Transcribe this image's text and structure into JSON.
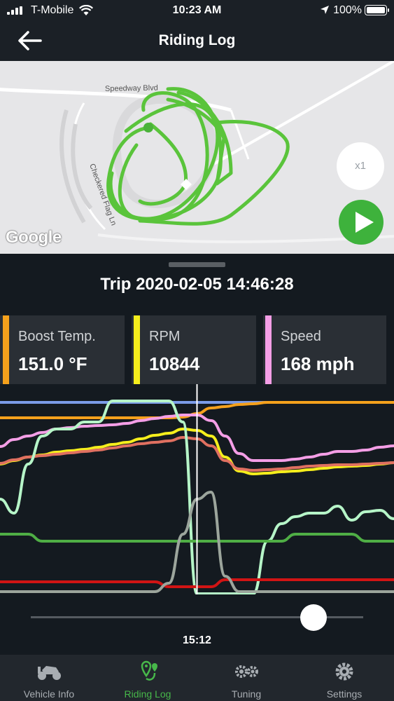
{
  "status_bar": {
    "carrier": "T-Mobile",
    "time": "10:23 AM",
    "battery": "100%"
  },
  "header": {
    "title": "Riding Log"
  },
  "map": {
    "street_1": "Speedway Blvd",
    "street_2": "Checkered Flag Ln",
    "playback_speed": "x1",
    "attribution": "Google"
  },
  "trip": {
    "title": "Trip 2020-02-05 14:46:28"
  },
  "metrics": [
    {
      "label": "Boost Temp.",
      "value": "151.0 °F",
      "color": "#f5a11c"
    },
    {
      "label": "RPM",
      "value": "10844",
      "color": "#f5ee1c"
    },
    {
      "label": "Speed",
      "value": "168 mph",
      "color": "#f49ee6"
    }
  ],
  "chart_data": {
    "type": "line",
    "series": [
      {
        "color": "#7b9be8",
        "values": [
          2,
          2,
          2,
          2,
          2,
          2,
          2,
          2,
          2,
          2,
          2,
          2,
          2,
          2,
          2,
          2,
          2,
          2,
          2,
          2,
          2,
          2,
          2,
          2,
          2,
          2,
          2,
          2,
          2
        ]
      },
      {
        "color": "#f5a11c",
        "values": [
          24,
          24,
          24,
          24,
          24,
          24,
          24,
          24,
          24,
          24,
          24,
          24,
          24,
          23,
          18,
          10,
          8,
          5,
          4,
          2,
          2,
          2,
          2,
          2,
          2,
          2,
          2,
          2,
          2
        ]
      },
      {
        "color": "#f49ee6",
        "values": [
          65,
          55,
          50,
          45,
          40,
          38,
          36,
          35,
          34,
          32,
          28,
          25,
          22,
          20,
          20,
          28,
          50,
          75,
          85,
          85,
          85,
          83,
          80,
          76,
          72,
          72,
          70,
          66,
          64
        ]
      },
      {
        "color": "#f5ee1c",
        "values": [
          90,
          85,
          80,
          77,
          73,
          71,
          69,
          66,
          62,
          59,
          54,
          49,
          46,
          40,
          42,
          50,
          80,
          100,
          104,
          103,
          101,
          100,
          98,
          96,
          94,
          93,
          92,
          90,
          88
        ]
      },
      {
        "color": "#e07060",
        "values": [
          89,
          84,
          80,
          78,
          76,
          74,
          72,
          70,
          67,
          64,
          61,
          59,
          57,
          52,
          54,
          64,
          85,
          97,
          99,
          98,
          97,
          95,
          93,
          92,
          91,
          91,
          90,
          89,
          88
        ]
      },
      {
        "color": "#b6f5c8",
        "values": [
          140,
          160,
          90,
          50,
          40,
          40,
          30,
          30,
          0,
          0,
          0,
          0,
          0,
          30,
          275,
          275,
          275,
          275,
          275,
          200,
          175,
          165,
          160,
          160,
          150,
          170,
          158,
          156,
          168
        ]
      },
      {
        "color": "#4fae45",
        "values": [
          190,
          190,
          190,
          200,
          200,
          200,
          200,
          200,
          200,
          200,
          200,
          200,
          200,
          200,
          200,
          200,
          200,
          200,
          200,
          200,
          200,
          190,
          190,
          190,
          190,
          190,
          200,
          200,
          200
        ]
      },
      {
        "color": "#d11414",
        "values": [
          258,
          258,
          258,
          258,
          258,
          258,
          258,
          258,
          258,
          258,
          258,
          258,
          265,
          265,
          265,
          265,
          255,
          255,
          255,
          255,
          255,
          255,
          255,
          255,
          255,
          255,
          255,
          255,
          255
        ]
      },
      {
        "color": "#9ca59c",
        "values": [
          272,
          272,
          272,
          272,
          272,
          272,
          272,
          272,
          272,
          272,
          272,
          272,
          260,
          190,
          140,
          130,
          250,
          272,
          272,
          272,
          272,
          272,
          272,
          272,
          272,
          272,
          272,
          272,
          272
        ]
      }
    ],
    "cursor_fraction": 0.5
  },
  "playback": {
    "time": "15:12",
    "position": 0.85
  },
  "tabs": [
    {
      "label": "Vehicle Info",
      "icon": "motorcycle-info-icon"
    },
    {
      "label": "Riding Log",
      "icon": "route-pin-icon"
    },
    {
      "label": "Tuning",
      "icon": "tuning-gears-icon"
    },
    {
      "label": "Settings",
      "icon": "gear-icon"
    }
  ]
}
